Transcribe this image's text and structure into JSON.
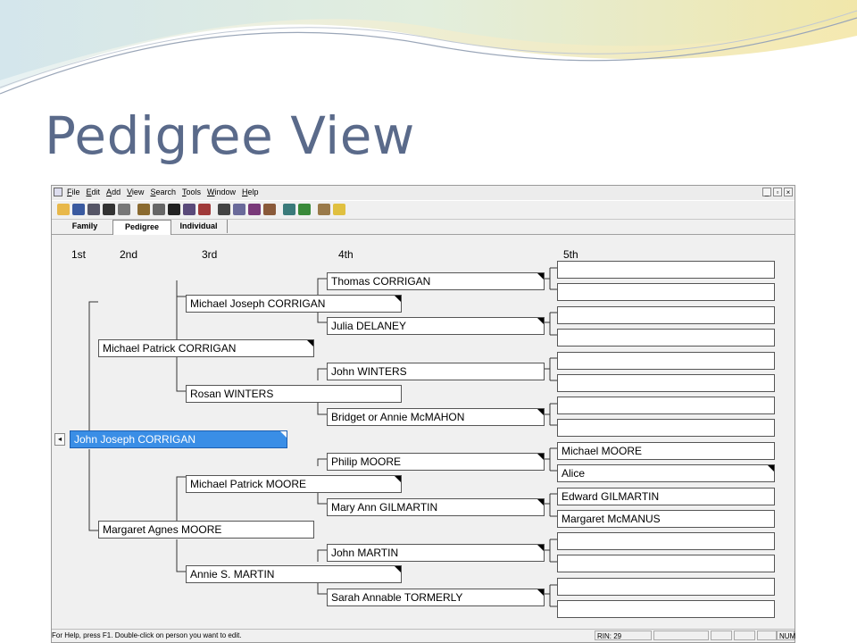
{
  "slide": {
    "title": "Pedigree View"
  },
  "menu": {
    "items": [
      "File",
      "Edit",
      "Add",
      "View",
      "Search",
      "Tools",
      "Window",
      "Help"
    ],
    "window_controls": [
      "_",
      "▫",
      "×"
    ]
  },
  "tabs": [
    "Family",
    "Pedigree",
    "Individual"
  ],
  "generations": [
    "1st",
    "2nd",
    "3rd",
    "4th",
    "5th"
  ],
  "pedigree": {
    "g1": "John Joseph CORRIGAN",
    "g2": [
      "Michael Patrick CORRIGAN",
      "Margaret Agnes MOORE"
    ],
    "g3": [
      "Michael Joseph CORRIGAN",
      "Rosan WINTERS",
      "Michael Patrick MOORE",
      "Annie S. MARTIN"
    ],
    "g4": [
      "Thomas CORRIGAN",
      "Julia DELANEY",
      "John WINTERS",
      "Bridget or Annie McMAHON",
      "Philip MOORE",
      "Mary Ann GILMARTIN",
      "John MARTIN",
      "Sarah Annable TORMERLY"
    ],
    "g5": [
      "",
      "",
      "",
      "",
      "",
      "",
      "",
      "",
      "Michael MOORE",
      "Alice",
      "Edward GILMARTIN",
      "Margaret McMANUS",
      "",
      "",
      "",
      ""
    ]
  },
  "status": {
    "message": "For Help, press F1. Double-click on person you want to edit.",
    "rin": "RIN: 29",
    "num": "NUM"
  },
  "colors": {
    "selected": "#3a8ee6",
    "title": "#5a6a8a"
  }
}
